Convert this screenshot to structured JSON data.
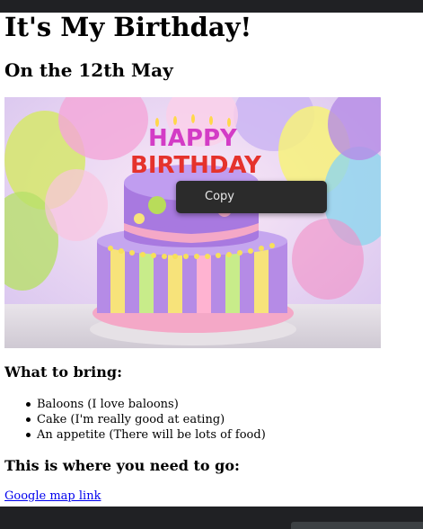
{
  "page": {
    "title": "It's My Birthday!",
    "subtitle": "On the 12th May"
  },
  "image": {
    "cake_text_top": "HAPPY",
    "cake_text_bottom": "BIRTHDAY"
  },
  "context_menu": {
    "copy_label": "Copy"
  },
  "bring": {
    "heading": "What to bring:",
    "items": [
      "Baloons (I love baloons)",
      "Cake (I'm really good at eating)",
      "An appetite (There will be lots of food)"
    ]
  },
  "location": {
    "heading": "This is where you need to go:",
    "link_label": "Google map link"
  },
  "colors": {
    "link": "#0000ee",
    "browser_chrome": "#202124",
    "menu_bg": "#2b2b2b"
  }
}
